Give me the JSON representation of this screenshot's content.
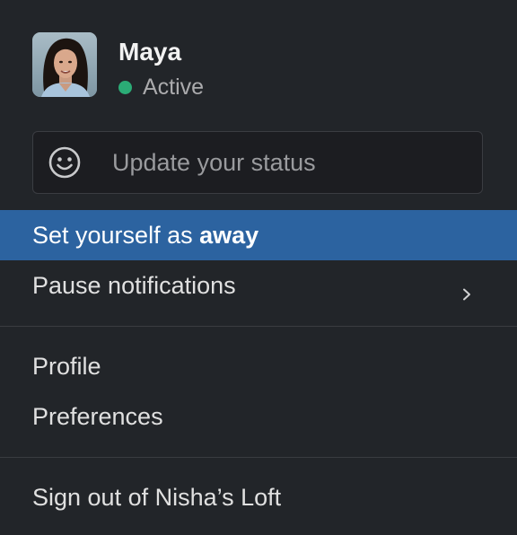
{
  "user": {
    "name": "Maya",
    "presence": "Active",
    "presence_color": "#2bac76",
    "avatar_icon": "user-photo"
  },
  "status": {
    "icon": "smiley-icon",
    "placeholder": "Update your status"
  },
  "menu": {
    "away": {
      "prefix": "Set yourself as ",
      "emphasis": "away",
      "highlighted": true
    },
    "pause": {
      "label": "Pause notifications",
      "icon": "chevron-right-icon"
    },
    "profile": {
      "label": "Profile"
    },
    "preferences": {
      "label": "Preferences"
    },
    "sign_out": {
      "label": "Sign out of Nisha’s Loft"
    }
  },
  "colors": {
    "background": "#222529",
    "highlight": "#2c63a0",
    "divider": "#3a3c40"
  }
}
